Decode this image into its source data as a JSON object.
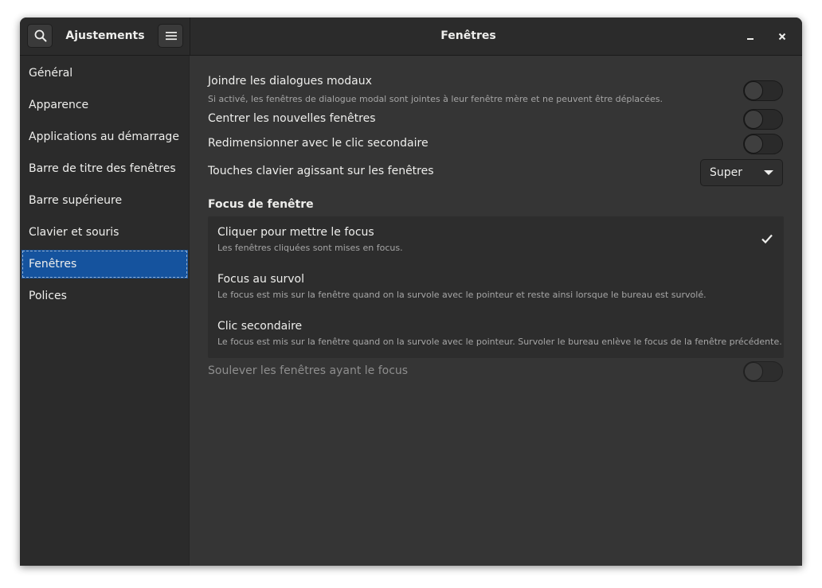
{
  "app": {
    "title": "Ajustements",
    "window_title": "Fenêtres"
  },
  "icons": {
    "search": "search-icon",
    "menu": "hamburger-menu-icon",
    "minimize": "minimize-icon",
    "close": "close-icon",
    "dropdown": "dropdown-arrow-icon",
    "check": "checkmark-icon"
  },
  "sidebar": {
    "items": [
      {
        "label": "Général"
      },
      {
        "label": "Apparence"
      },
      {
        "label": "Applications au démarrage"
      },
      {
        "label": "Barre de titre des fenêtres"
      },
      {
        "label": "Barre supérieure"
      },
      {
        "label": "Clavier et souris"
      },
      {
        "label": "Fenêtres",
        "active": true
      },
      {
        "label": "Polices"
      }
    ]
  },
  "settings": {
    "attach_modal": {
      "label": "Joindre les dialogues modaux",
      "description": "Si activé, les fenêtres de dialogue modal sont jointes à leur fenêtre mère et ne peuvent être déplacées.",
      "enabled": false
    },
    "center_new": {
      "label": "Centrer les nouvelles fenêtres",
      "enabled": false
    },
    "resize_secondary": {
      "label": "Redimensionner avec le clic secondaire",
      "enabled": false
    },
    "action_key": {
      "label": "Touches clavier agissant sur les fenêtres",
      "value": "Super"
    }
  },
  "focus_section": {
    "title": "Focus de fenêtre",
    "options": [
      {
        "label": "Cliquer pour mettre le focus",
        "description": "Les fenêtres cliquées sont mises en focus.",
        "selected": true
      },
      {
        "label": "Focus au survol",
        "description": "Le focus est mis sur la fenêtre quand on la survole avec le pointeur et reste ainsi lorsque le bureau est survolé.",
        "selected": false
      },
      {
        "label": "Clic secondaire",
        "description": "Le focus est mis sur la fenêtre quand on la survole avec le pointeur. Survoler le bureau enlève le focus de la fenêtre précédente.",
        "selected": false
      }
    ],
    "raise_on_focus": {
      "label": "Soulever les fenêtres ayant le focus",
      "enabled": false,
      "sensitive": false
    }
  },
  "colors": {
    "accent": "#15539e",
    "background": "#353535",
    "sidebar": "#2b2b2b"
  }
}
